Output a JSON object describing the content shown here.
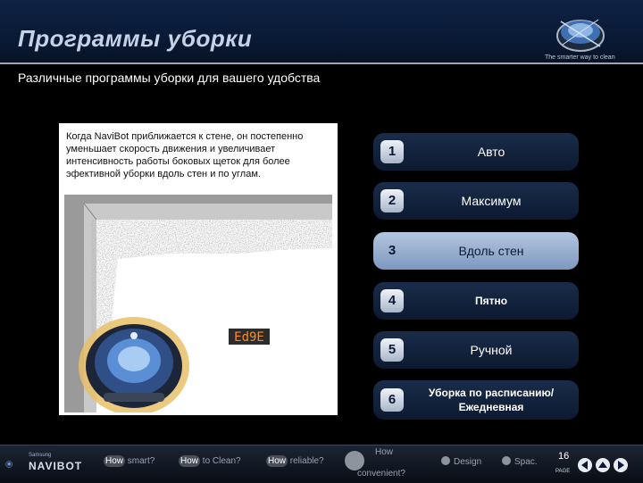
{
  "header": {
    "title": "Программы уборки",
    "tagline": "The smarter way to clean",
    "subtitle": "Различные программы уборки для вашего удобства"
  },
  "panel": {
    "description": "Когда NaviBot приближается к стене, он постепенно уменьшает скорость движения и увеличивает интенсивность работы боковых щеток для более эфективной уборки вдоль стен и по углам.",
    "display_code": "Ed9E"
  },
  "modes": [
    {
      "num": "1",
      "label": "Авто"
    },
    {
      "num": "2",
      "label": "Максимум"
    },
    {
      "num": "3",
      "label": "Вдоль стен"
    },
    {
      "num": "4",
      "label": "Пятно"
    },
    {
      "num": "5",
      "label": "Ручной"
    },
    {
      "num": "6",
      "label": "Уборка по расписанию/ Ежедневная"
    }
  ],
  "active_mode": "3",
  "footer": {
    "brand_small": "Samsung",
    "brand_name": "NAVIBOT",
    "nav": [
      {
        "hl": "How",
        "rest": " smart?"
      },
      {
        "hl": "How",
        "rest": " to Clean?"
      },
      {
        "hl": "How",
        "rest": " reliable?"
      },
      {
        "top": "How",
        "bottom": "convenient?"
      },
      {
        "label": "Design"
      },
      {
        "label": "Spac."
      }
    ],
    "page_number": "16",
    "page_label": "PAGE"
  },
  "colors": {
    "header_bg": "#0a1a36",
    "mode_bg": "#10223e",
    "mode_active_bg": "#9fb4d3",
    "panel_bg": "#ffffff"
  }
}
